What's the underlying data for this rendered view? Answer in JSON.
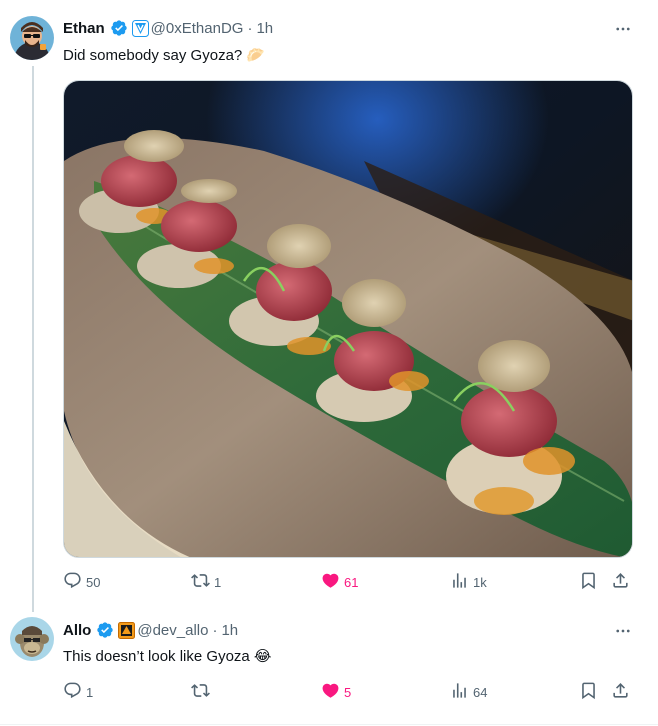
{
  "tweets": [
    {
      "author": {
        "name": "Ethan",
        "handle": "@0xEthanDG",
        "time": "1h",
        "verified": true,
        "affiliate_badge": "shield-v-badge"
      },
      "text": "Did somebody say Gyoza? 🥟",
      "media": {
        "type": "photo",
        "subject": "wagyu-truffle-gyoza-on-bamboo-leaf"
      },
      "actions": {
        "replies": "50",
        "reposts": "1",
        "likes": "61",
        "views": "1k",
        "liked": true
      }
    },
    {
      "author": {
        "name": "Allo",
        "handle": "@dev_allo",
        "time": "1h",
        "verified": true,
        "affiliate_badge": "orange-square-badge"
      },
      "text": "This doesn’t look like Gyoza 😂",
      "actions": {
        "replies": "1",
        "reposts": "",
        "likes": "5",
        "views": "64",
        "liked": true
      }
    }
  ],
  "colors": {
    "verified_blue": "#1d9bf0",
    "like_pink": "#f91880",
    "secondary_text": "#536471",
    "thread_line": "#cfd9de"
  },
  "separator": "·"
}
